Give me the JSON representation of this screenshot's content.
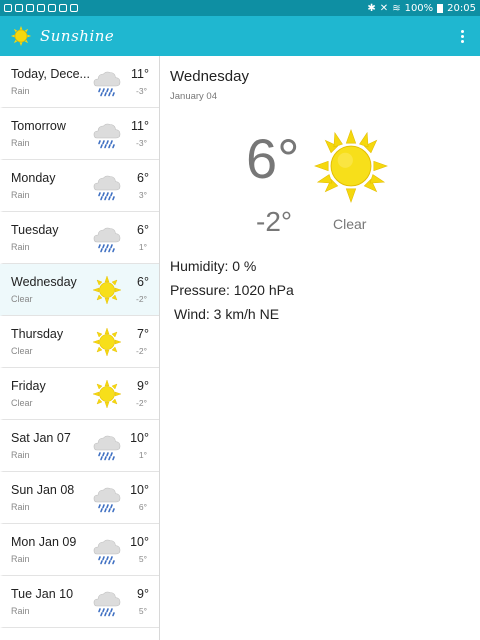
{
  "status_bar": {
    "battery": "100%",
    "time": "20:05"
  },
  "app": {
    "title": "Sunshine"
  },
  "forecast": [
    {
      "day": "Today, Dece...",
      "desc": "Rain",
      "high": "11°",
      "low": "-3°",
      "icon": "rain-icon"
    },
    {
      "day": "Tomorrow",
      "desc": "Rain",
      "high": "11°",
      "low": "-3°",
      "icon": "rain-icon"
    },
    {
      "day": "Monday",
      "desc": "Rain",
      "high": "6°",
      "low": "3°",
      "icon": "rain-icon"
    },
    {
      "day": "Tuesday",
      "desc": "Rain",
      "high": "6°",
      "low": "1°",
      "icon": "rain-icon"
    },
    {
      "day": "Wednesday",
      "desc": "Clear",
      "high": "6°",
      "low": "-2°",
      "icon": "sun-icon"
    },
    {
      "day": "Thursday",
      "desc": "Clear",
      "high": "7°",
      "low": "-2°",
      "icon": "sun-icon"
    },
    {
      "day": "Friday",
      "desc": "Clear",
      "high": "9°",
      "low": "-2°",
      "icon": "sun-icon"
    },
    {
      "day": "Sat Jan 07",
      "desc": "Rain",
      "high": "10°",
      "low": "1°",
      "icon": "rain-icon"
    },
    {
      "day": "Sun Jan 08",
      "desc": "Rain",
      "high": "10°",
      "low": "6°",
      "icon": "rain-icon"
    },
    {
      "day": "Mon Jan 09",
      "desc": "Rain",
      "high": "10°",
      "low": "5°",
      "icon": "rain-icon"
    },
    {
      "day": "Tue Jan 10",
      "desc": "Rain",
      "high": "9°",
      "low": "5°",
      "icon": "rain-icon"
    }
  ],
  "detail": {
    "day": "Wednesday",
    "date": "January 04",
    "high": "6°",
    "low": "-2°",
    "condition": "Clear",
    "humidity": "Humidity: 0 %",
    "pressure": "Pressure: 1020 hPa",
    "wind": "Wind: 3 km/h NE"
  },
  "colors": {
    "status_bar": "#0e8fa3",
    "app_bar": "#1fb7d0",
    "sun": "#f5d80e",
    "cloud": "#d9d9d9",
    "rain": "#3e6fc2"
  }
}
